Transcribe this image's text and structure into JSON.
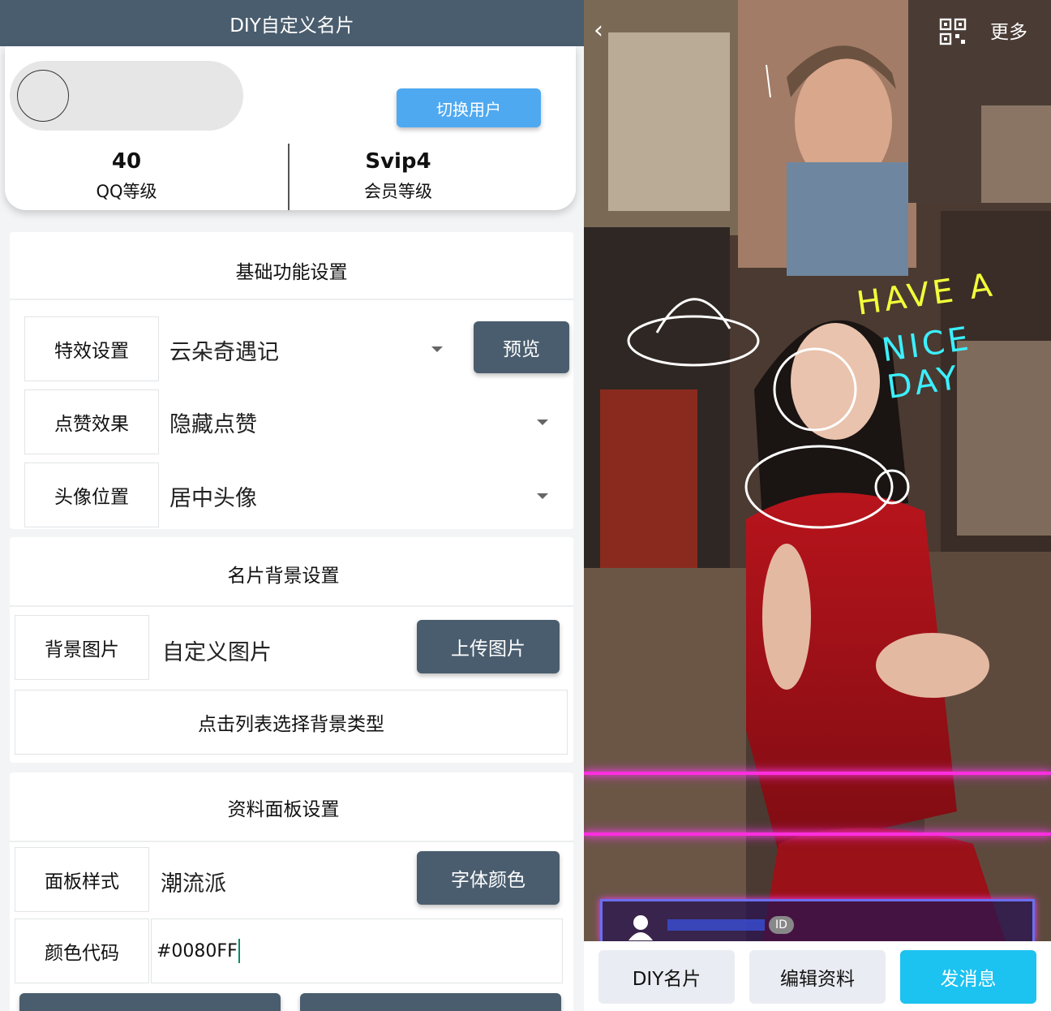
{
  "left": {
    "title": "DIY自定义名片",
    "profile": {
      "switch_user": "切换用户",
      "qq_level_value": "40",
      "qq_level_label": "QQ等级",
      "vip_value": "Svip4",
      "vip_label": "会员等级"
    },
    "basic": {
      "title": "基础功能设置",
      "rows": [
        {
          "label": "特效设置",
          "value": "云朵奇遇记",
          "button": "预览"
        },
        {
          "label": "点赞效果",
          "value": "隐藏点赞"
        },
        {
          "label": "头像位置",
          "value": "居中头像"
        }
      ]
    },
    "background": {
      "title": "名片背景设置",
      "label": "背景图片",
      "value": "自定义图片",
      "upload": "上传图片",
      "select_list": "点击列表选择背景类型"
    },
    "panel": {
      "title": "资料面板设置",
      "style_label": "面板样式",
      "style_value": "潮流派",
      "font_color": "字体颜色",
      "color_label": "颜色代码",
      "color_value": "#0080FF"
    }
  },
  "right": {
    "more": "更多",
    "doodle_text_1": "HAVE A",
    "doodle_text_2": "NICE DAY",
    "id_badge": "ID",
    "buttons": {
      "diy": "DIY名片",
      "edit": "编辑资料",
      "message": "发消息"
    },
    "colors": {
      "neon": "#ff2ee0",
      "send_button": "#1cc2f0"
    }
  }
}
